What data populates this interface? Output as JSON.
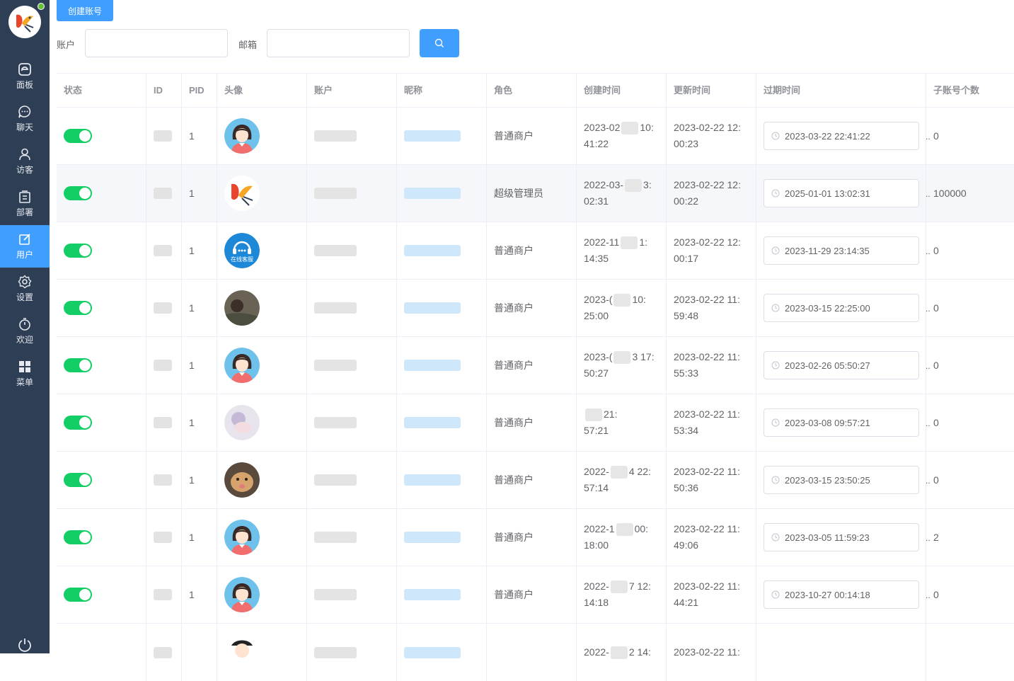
{
  "sidebar": {
    "items": [
      {
        "label": "面板",
        "icon": "dashboard-icon"
      },
      {
        "label": "聊天",
        "icon": "chat-icon"
      },
      {
        "label": "访客",
        "icon": "user-icon"
      },
      {
        "label": "部署",
        "icon": "deploy-icon"
      },
      {
        "label": "用户",
        "icon": "edit-icon",
        "active": true
      },
      {
        "label": "设置",
        "icon": "gear-icon"
      },
      {
        "label": "欢迎",
        "icon": "timer-icon"
      },
      {
        "label": "菜单",
        "icon": "grid-icon"
      }
    ]
  },
  "toolbar": {
    "create_label": "创建账号",
    "account_label": "账户",
    "email_label": "邮箱",
    "account_value": "",
    "email_value": ""
  },
  "table": {
    "headers": [
      "状态",
      "ID",
      "PID",
      "头像",
      "账户",
      "昵称",
      "角色",
      "创建时间",
      "更新时间",
      "过期时间",
      "子账号个数"
    ],
    "rows": [
      {
        "pid": "1",
        "role": "普通商户",
        "created_1": "2023-02",
        "created_2": "10:",
        "created_3": "41:22",
        "updated_1": "2023-02-22 12:",
        "updated_2": "00:23",
        "expire": "2023-03-22 22:41:22",
        "sub": "0",
        "avatar": "girl"
      },
      {
        "pid": "1",
        "role": "超级管理员",
        "created_1": "2022-03-",
        "created_2": "3:",
        "created_3": "02:31",
        "updated_1": "2023-02-22 12:",
        "updated_2": "00:22",
        "expire": "2025-01-01 13:02:31",
        "sub": "100000",
        "avatar": "bird"
      },
      {
        "pid": "1",
        "role": "普通商户",
        "created_1": "2022-11",
        "created_2": "1:",
        "created_3": "14:35",
        "updated_1": "2023-02-22 12:",
        "updated_2": "00:17",
        "expire": "2023-11-29 23:14:35",
        "sub": "0",
        "avatar": "service",
        "avatar_text": "在线客服"
      },
      {
        "pid": "1",
        "role": "普通商户",
        "created_1": "2023-(",
        "created_2": "10:",
        "created_3": "25:00",
        "updated_1": "2023-02-22 11:",
        "updated_2": "59:48",
        "expire": "2023-03-15 22:25:00",
        "sub": "0",
        "avatar": "photo-dark"
      },
      {
        "pid": "1",
        "role": "普通商户",
        "created_1": "2023-(",
        "created_2": "3 17:",
        "created_3": "50:27",
        "updated_1": "2023-02-22 11:",
        "updated_2": "55:33",
        "expire": "2023-02-26 05:50:27",
        "sub": "0",
        "avatar": "girl"
      },
      {
        "pid": "1",
        "role": "普通商户",
        "created_1": "",
        "created_2": "21:",
        "created_3": "57:21",
        "updated_1": "2023-02-22 11:",
        "updated_2": "53:34",
        "expire": "2023-03-08 09:57:21",
        "sub": "0",
        "avatar": "anime"
      },
      {
        "pid": "1",
        "role": "普通商户",
        "created_1": "2022-",
        "created_2": "4 22:",
        "created_3": "57:14",
        "updated_1": "2023-02-22 11:",
        "updated_2": "50:36",
        "expire": "2023-03-15 23:50:25",
        "sub": "0",
        "avatar": "cat"
      },
      {
        "pid": "1",
        "role": "普通商户",
        "created_1": "2022-1",
        "created_2": "00:",
        "created_3": "18:00",
        "updated_1": "2023-02-22 11:",
        "updated_2": "49:06",
        "expire": "2023-03-05 11:59:23",
        "sub": "2",
        "avatar": "girl"
      },
      {
        "pid": "1",
        "role": "普通商户",
        "created_1": "2022-",
        "created_2": "7 12:",
        "created_3": "14:18",
        "updated_1": "2023-02-22 11:",
        "updated_2": "44:21",
        "expire": "2023-10-27 00:14:18",
        "sub": "0",
        "avatar": "girl"
      },
      {
        "pid": "",
        "role": "",
        "created_1": "2022-",
        "created_2": "2 14:",
        "created_3": "",
        "updated_1": "2023-02-22 11:",
        "updated_2": "",
        "expire": "",
        "sub": "",
        "avatar": "cartoon"
      }
    ]
  },
  "colors": {
    "sidebar_bg": "#2e3e54",
    "accent": "#409eff",
    "switch_on": "#13ce66",
    "online_dot": "#67c23a"
  }
}
